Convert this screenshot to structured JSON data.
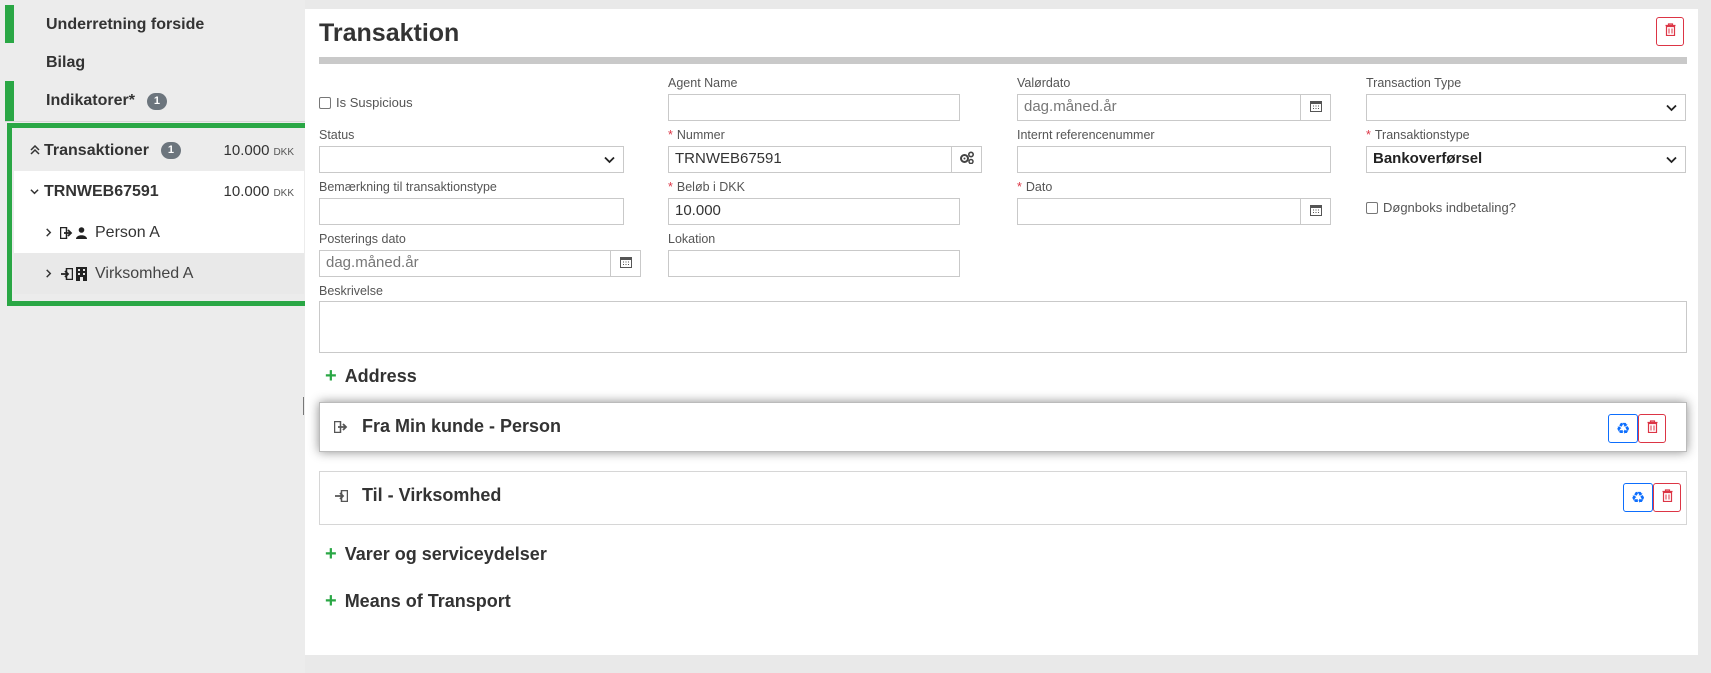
{
  "sidebar": {
    "items": [
      {
        "label": "Underretning forside"
      },
      {
        "label": "Bilag"
      },
      {
        "label": "Indikatorer*",
        "badge": "1"
      }
    ],
    "transactions": {
      "label": "Transaktioner",
      "badge": "1",
      "amount": "10.000",
      "currency": "DKK",
      "items": [
        {
          "label": "TRNWEB67591",
          "amount": "10.000",
          "currency": "DKK",
          "children": [
            {
              "label": "Person A",
              "icons": [
                "sign-out-icon",
                "user-icon"
              ]
            },
            {
              "label": "Virksomhed A",
              "icons": [
                "sign-in-icon",
                "building-icon"
              ]
            }
          ]
        }
      ]
    }
  },
  "panel": {
    "title": "Transaktion",
    "fields": {
      "is_suspicious": {
        "label": "Is Suspicious",
        "checked": false
      },
      "agent_name": {
        "label": "Agent Name",
        "value": ""
      },
      "valoerdato": {
        "label": "Valørdato",
        "placeholder": "dag.måned.år"
      },
      "transaction_type": {
        "label": "Transaction Type",
        "value": ""
      },
      "status": {
        "label": "Status",
        "value": ""
      },
      "nummer": {
        "label": "Nummer",
        "value": "TRNWEB67591",
        "required": true
      },
      "internt_ref": {
        "label": "Internt referencenummer",
        "value": ""
      },
      "transaktionstype": {
        "label": "Transaktionstype",
        "value": "Bankoverførsel",
        "required": true
      },
      "bemaerkning": {
        "label": "Bemærkning til transaktionstype",
        "value": ""
      },
      "beloeb": {
        "label": "Beløb i DKK",
        "value": "10.000",
        "required": true
      },
      "dato": {
        "label": "Dato",
        "value": "",
        "required": true
      },
      "doegnboks": {
        "label": "Døgnboks indbetaling?",
        "checked": false
      },
      "posterings_dato": {
        "label": "Posterings dato",
        "placeholder": "dag.måned.år"
      },
      "lokation": {
        "label": "Lokation",
        "value": ""
      },
      "beskrivelse": {
        "label": "Beskrivelse",
        "value": ""
      }
    },
    "sections": {
      "address": "Address",
      "from_party": "Fra Min kunde - Person",
      "to_party": "Til - Virksomhed",
      "goods": "Varer og serviceydelser",
      "transport": "Means of Transport"
    }
  },
  "colors": {
    "accent_green": "#2aa745",
    "danger": "#dc3545",
    "primary": "#0d6efd",
    "badge": "#6c757d"
  }
}
